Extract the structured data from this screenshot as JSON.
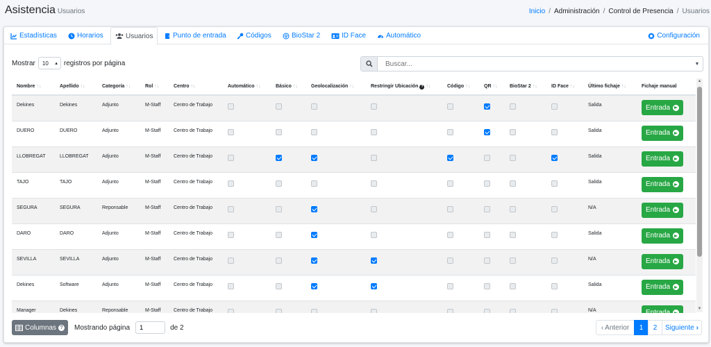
{
  "header": {
    "title": "Asistencia",
    "subtitle": "Usuarios",
    "breadcrumb": {
      "home": "Inicio",
      "sep": "/",
      "admin": "Administración",
      "control": "Control de Presencia",
      "current": "Usuarios"
    }
  },
  "tabs": [
    {
      "label": "Estadísticas",
      "icon": "chart-icon"
    },
    {
      "label": "Horarios",
      "icon": "clock-icon"
    },
    {
      "label": "Usuarios",
      "icon": "users-icon"
    },
    {
      "label": "Punto de entrada",
      "icon": "door-icon"
    },
    {
      "label": "Códigos",
      "icon": "key-icon"
    },
    {
      "label": "BioStar 2",
      "icon": "fingerprint-icon"
    },
    {
      "label": "ID Face",
      "icon": "id-card-icon"
    },
    {
      "label": "Automático",
      "icon": "gauge-icon"
    }
  ],
  "config_tab": {
    "label": "Configuración",
    "icon": "gear-icon"
  },
  "controls": {
    "show_label": "Mostrar",
    "page_size": "10",
    "per_page_label": "registros por página",
    "search_placeholder": "Buscar..."
  },
  "columns": [
    "Nombre",
    "Apellido",
    "Categoría",
    "Rol",
    "Centro",
    "Automático",
    "Básico",
    "Geolocalización",
    "Restringir Ubicación",
    "Código",
    "QR",
    "BioStar 2",
    "ID Face",
    "Último fichaje",
    "Fichaje manual"
  ],
  "entrada_label": "Entrada",
  "rows": [
    {
      "nombre": "Dekines",
      "apellido": "Dekines",
      "categoria": "Adjunto",
      "rol": "M-Staff",
      "centro": "Centro de Trabajo",
      "checks": [
        false,
        false,
        false,
        false,
        false,
        true,
        false,
        false
      ],
      "ultimo": "Salida"
    },
    {
      "nombre": "DUERO",
      "apellido": "DUERO",
      "categoria": "Adjunto",
      "rol": "M-Staff",
      "centro": "Centro de Trabajo",
      "checks": [
        false,
        false,
        false,
        false,
        false,
        true,
        false,
        false
      ],
      "ultimo": "Salida"
    },
    {
      "nombre": "LLOBREGAT",
      "apellido": "LLOBREGAT",
      "categoria": "Adjunto",
      "rol": "M-Staff",
      "centro": "Centro de Trabajo",
      "checks": [
        false,
        true,
        true,
        false,
        true,
        false,
        false,
        true
      ],
      "ultimo": "Salida"
    },
    {
      "nombre": "TAJO",
      "apellido": "TAJO",
      "categoria": "Adjunto",
      "rol": "M-Staff",
      "centro": "Centro de Trabajo",
      "checks": [
        false,
        false,
        false,
        false,
        false,
        false,
        false,
        false
      ],
      "ultimo": "Salida"
    },
    {
      "nombre": "SEGURA",
      "apellido": "SEGURA",
      "categoria": "Reponsable",
      "rol": "M-Staff",
      "centro": "Centro de Trabajo",
      "checks": [
        false,
        false,
        true,
        false,
        false,
        false,
        false,
        false
      ],
      "ultimo": "N/A"
    },
    {
      "nombre": "DARO",
      "apellido": "DARO",
      "categoria": "Adjunto",
      "rol": "M-Staff",
      "centro": "Centro de Trabajo",
      "checks": [
        false,
        false,
        true,
        false,
        false,
        false,
        false,
        false
      ],
      "ultimo": "Salida"
    },
    {
      "nombre": "SEVILLA",
      "apellido": "SEVILLA",
      "categoria": "Adjunto",
      "rol": "M-Staff",
      "centro": "Centro de Trabajo",
      "checks": [
        false,
        false,
        true,
        true,
        false,
        false,
        false,
        false
      ],
      "ultimo": "N/A"
    },
    {
      "nombre": "Dekines",
      "apellido": "Software",
      "categoria": "Adjunto",
      "rol": "M-Staff",
      "centro": "Centro de Trabajo",
      "checks": [
        false,
        false,
        true,
        true,
        false,
        false,
        false,
        false
      ],
      "ultimo": "Salida"
    },
    {
      "nombre": "Manager",
      "apellido": "Dekines",
      "categoria": "Reponsable",
      "rol": "M-Staff",
      "centro": "Centro de Trabajo",
      "checks": [
        false,
        false,
        false,
        false,
        false,
        false,
        false,
        false
      ],
      "ultimo": "N/A"
    }
  ],
  "footer": {
    "columns_button": "Columnas",
    "showing_page": "Mostrando página",
    "page_value": "1",
    "of_label": "de 2",
    "prev": "Anterior",
    "pages": [
      "1",
      "2"
    ],
    "next": "Siguiente"
  },
  "colors": {
    "primary": "#007bff",
    "success": "#28a745",
    "secondary": "#6c757d"
  }
}
